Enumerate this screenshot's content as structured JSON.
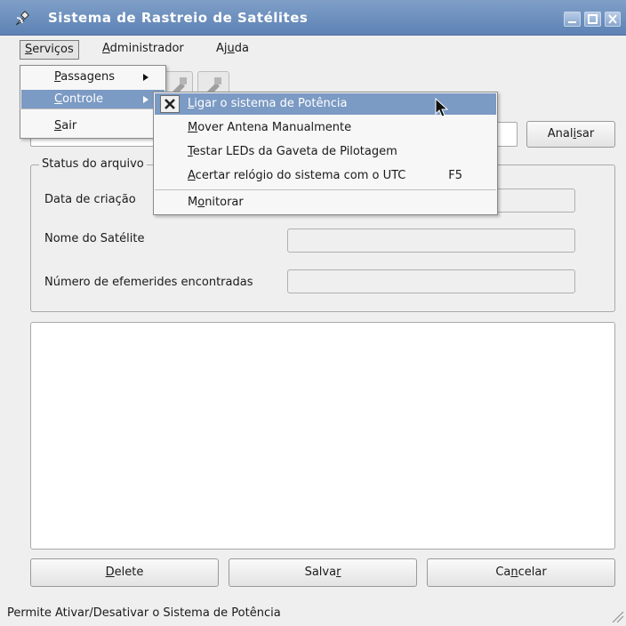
{
  "window": {
    "title": "Sistema de Rastreio de Satélites"
  },
  "menubar": {
    "servicos": {
      "pre": "",
      "key": "S",
      "post": "erviços"
    },
    "administrador": {
      "pre": "",
      "key": "A",
      "post": "dministrador"
    },
    "ajuda": {
      "pre": "Aj",
      "key": "u",
      "post": "da"
    }
  },
  "servicos_menu": {
    "passagens": {
      "pre": "",
      "key": "P",
      "post": "assagens"
    },
    "controle": {
      "pre": "",
      "key": "C",
      "post": "ontrole"
    },
    "sair": {
      "pre": "",
      "key": "S",
      "post": "air"
    }
  },
  "controle_menu": {
    "ligar": {
      "pre": "",
      "key": "L",
      "post": "igar o sistema de Potência"
    },
    "mover": {
      "pre": "",
      "key": "M",
      "post": "over Antena Manualmente"
    },
    "testar": {
      "pre": "",
      "key": "T",
      "post": "estar LEDs da Gaveta de Pilotagem"
    },
    "acertar": {
      "pre": "",
      "key": "A",
      "post": "certar relógio do sistema com o UTC",
      "shortcut": "F5"
    },
    "monitorar": {
      "pre": "M",
      "key": "o",
      "post": "nitorar"
    }
  },
  "file_row": {
    "analisar": {
      "pre": "Anal",
      "key": "i",
      "post": "sar"
    }
  },
  "status_group": {
    "legend": "Status do arquivo",
    "data_criacao": "Data de criação",
    "nome_satelite": "Nome do Satélite",
    "numero_efemerides": "Número de efemerides encontradas"
  },
  "buttons": {
    "delete": {
      "pre": "",
      "key": "D",
      "post": "elete"
    },
    "salvar": {
      "pre": "Salva",
      "key": "r",
      "post": ""
    },
    "cancelar": {
      "pre": "Ca",
      "key": "n",
      "post": "celar"
    }
  },
  "statusbar": {
    "text": "Permite Ativar/Desativar o Sistema de Potência"
  },
  "colors": {
    "titlebar": "#6f91c0",
    "menu_highlight": "#7b9ac4"
  }
}
